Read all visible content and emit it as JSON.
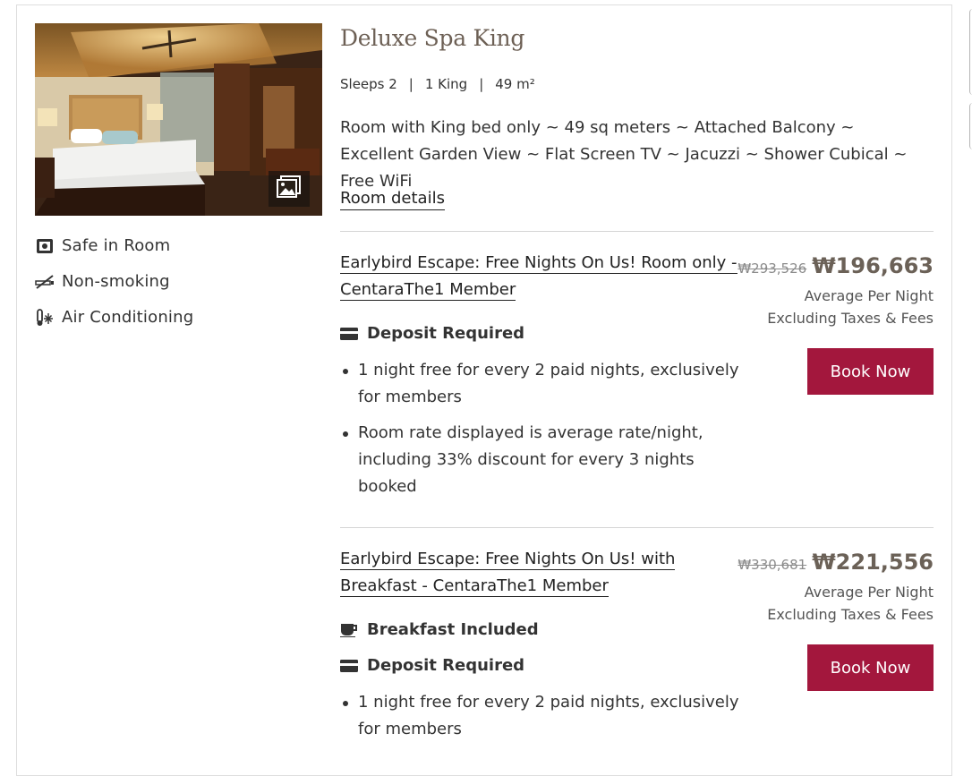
{
  "room": {
    "title": "Deluxe Spa King",
    "sleeps": "Sleeps 2",
    "bed": "1 King",
    "size": "49 m²",
    "description": "Room with King bed only ~ 49 sq meters ~ Attached Balcony ~ Excellent Garden View ~ Flat Screen TV ~ Jacuzzi ~ Shower Cubical ~ Free WiFi",
    "details_link": "Room details"
  },
  "amenities": [
    {
      "label": "Safe in Room",
      "icon": "safe-icon"
    },
    {
      "label": "Non-smoking",
      "icon": "no-smoking-icon"
    },
    {
      "label": "Air Conditioning",
      "icon": "air-conditioning-icon"
    }
  ],
  "rates": [
    {
      "name": "Earlybird Escape: Free Nights On Us! Room only - CentaraThe1 Member",
      "old_price": "₩293,526",
      "price": "₩196,663",
      "per_night": "Average Per Night",
      "taxes": "Excluding Taxes & Fees",
      "book_label": "Book Now",
      "features": [
        {
          "label": "Deposit Required",
          "icon": "credit-card-icon"
        }
      ],
      "bullets": [
        "1 night free for every 2 paid nights, exclusively for members",
        "Room rate displayed is average rate/night, including 33% discount for every 3 nights booked"
      ]
    },
    {
      "name": "Earlybird Escape: Free Nights On Us! with Breakfast - CentaraThe1 Member",
      "old_price": "₩330,681",
      "price": "₩221,556",
      "per_night": "Average Per Night",
      "taxes": "Excluding Taxes & Fees",
      "book_label": "Book Now",
      "features": [
        {
          "label": "Breakfast Included",
          "icon": "coffee-cup-icon"
        },
        {
          "label": "Deposit Required",
          "icon": "credit-card-icon"
        }
      ],
      "bullets": [
        "1 night free for every 2 paid nights, exclusively for members"
      ]
    }
  ],
  "gallery_icon": "image-gallery-icon",
  "colors": {
    "accent": "#a3173d",
    "title": "#6d6055",
    "price": "#6b6157"
  }
}
